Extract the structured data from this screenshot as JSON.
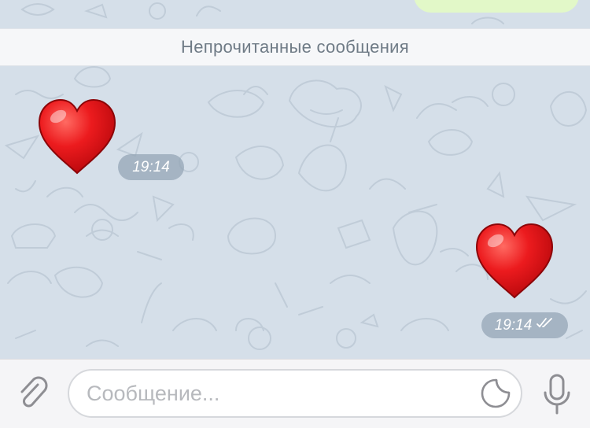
{
  "chat": {
    "unread_banner": "Непрочитанные сообщения",
    "messages": [
      {
        "direction": "incoming",
        "content_icon": "red-heart-emoji",
        "time": "19:14"
      },
      {
        "direction": "outgoing",
        "content_icon": "red-heart-emoji",
        "time": "19:14",
        "status_icon": "double-check-read-icon"
      }
    ]
  },
  "composer": {
    "placeholder": "Сообщение...",
    "attach_icon": "paperclip-icon",
    "sticker_icon": "sticker-icon",
    "mic_icon": "microphone-icon"
  },
  "colors": {
    "chat_background": "#d5dfe9",
    "outgoing_bubble": "#e2f8c8",
    "heart": "#e8191d",
    "time_pill": "#94a6b6"
  }
}
